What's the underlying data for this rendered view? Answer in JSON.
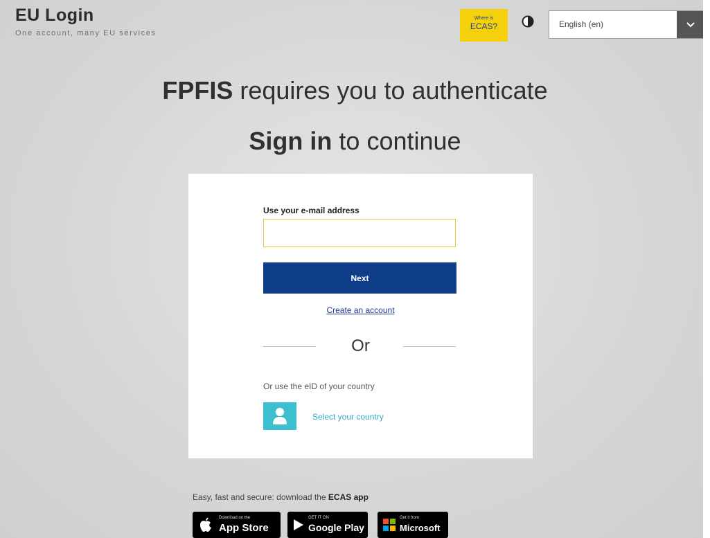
{
  "header": {
    "brand_title": "EU Login",
    "brand_subtitle": "One account, many EU services",
    "ecas_badge": {
      "line1": "Where is",
      "line2": "ECAS?"
    },
    "contrast_icon": "contrast-icon",
    "language": {
      "selected": "English (en)",
      "arrow_icon": "chevron-down-icon"
    }
  },
  "main": {
    "heading1": {
      "bold": "FPFIS",
      "rest": " requires you to authenticate"
    },
    "heading2": {
      "bold": "Sign in",
      "rest": " to continue"
    }
  },
  "login_card": {
    "email_label": "Use your e-mail address",
    "email_value": "",
    "next_label": "Next",
    "create_account": "Create an account",
    "or_text": "Or",
    "eid_label": "Or use the eID of your country",
    "select_country": "Select your country",
    "country_icon": "user-icon"
  },
  "footer": {
    "promo_text": "Easy, fast and secure: download the ",
    "promo_app": "ECAS app",
    "badges": [
      {
        "small": "Download on the",
        "big": "App Store",
        "icon": "apple-icon"
      },
      {
        "small": "GET IT ON",
        "big": "Google Play",
        "icon": "play-icon"
      },
      {
        "small": "Get it from",
        "big": "Microsoft",
        "icon": "windows-icon"
      }
    ]
  },
  "colors": {
    "accent_blue": "#0e3d8a",
    "ecas_yellow": "#f5d10b",
    "eid_teal": "#3cc0d0"
  }
}
